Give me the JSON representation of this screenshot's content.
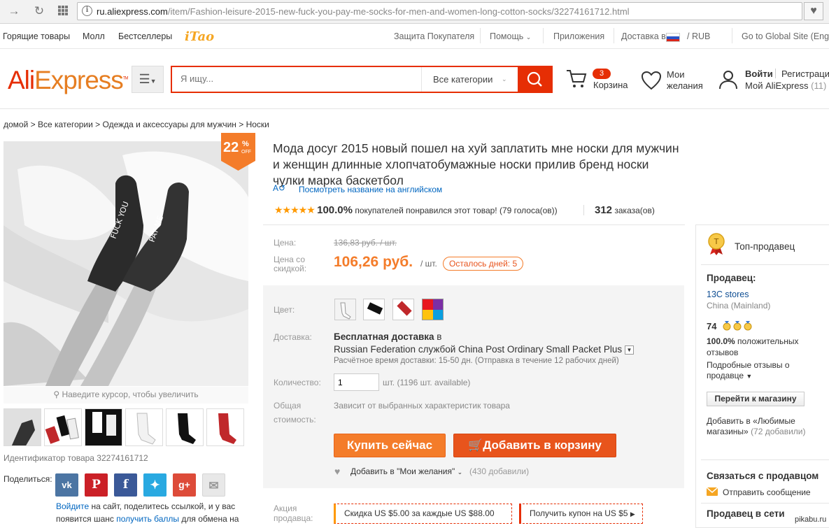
{
  "browser": {
    "url_host": "ru.aliexpress.com",
    "url_path": "/item/Fashion-leisure-2015-new-fuck-you-pay-me-socks-for-men-and-women-long-cotton-socks/32274161712.html"
  },
  "topnav": {
    "left": [
      "Горящие товары",
      "Молл",
      "Бестселлеры"
    ],
    "brand": "iTao",
    "buyer_protection": "Защита Покупателя",
    "help": "Помощь",
    "apps": "Приложения",
    "delivery": "Доставка в",
    "currency": "/ RUB",
    "global": "Go to Global Site (English)"
  },
  "header": {
    "logo_a": "Ali",
    "logo_b": "Express",
    "search_placeholder": "Я ищу...",
    "category": "Все категории",
    "cart_count": "3",
    "cart_label": "Корзина",
    "wish_line1": "Мои",
    "wish_line2": "желания",
    "login": "Войти",
    "register": "Регистрация",
    "my_ali": "Мой AliExpress",
    "my_count": "(11)"
  },
  "breadcrumb": "домой > Все категории > Одежда и аксессуары для мужчин > Носки",
  "gallery": {
    "discount_value": "22",
    "discount_pct": "%",
    "discount_off": "OFF",
    "zoom_hint": "Наведите курсор, чтобы увеличить",
    "product_id": "Идентификатор товара 32274161712"
  },
  "share": {
    "label": "Поделиться:",
    "login_link": "Войдите",
    "text1": " на сайт, поделитесь ссылкой, и у вас появится шанс ",
    "points_link": "получить баллы",
    "text2": " для обмена на"
  },
  "product": {
    "title": "Мода досуг 2015 новый пошел на хуй заплатить мне носки для мужчин и женщин длинные хлопчатобумажные носки прилив бренд носки чулки марка баскетбол",
    "translate": "Посмотреть название на английском",
    "rating_pct": "100.0%",
    "rating_text": "покупателей понравился этот товар! (79 голоса(ов))",
    "orders_count": "312",
    "orders_label": "заказа(ов)"
  },
  "price": {
    "label": "Цена:",
    "old": "136,83 руб. / шт.",
    "discount_label_1": "Цена со",
    "discount_label_2": "скидкой:",
    "new": "106,26 руб.",
    "unit": "/ шт.",
    "days_left": "Осталось дней: 5"
  },
  "sku": {
    "color_label": "Цвет:",
    "shipping_label": "Доставка:",
    "shipping_free": "Бесплатная доставка",
    "shipping_in": "в",
    "shipping_method": "Russian Federation службой China Post Ordinary Small Packet Plus",
    "shipping_time": "Расчётное время доставки: 15-50 дн. (Отправка в течение 12 рабочих дней)",
    "qty_label": "Количество:",
    "qty_value": "1",
    "qty_avail": "шт. (1196 шт. available)",
    "total_label_1": "Общая",
    "total_label_2": "стоимость:",
    "total_value": "Зависит от выбранных характеристик товара",
    "buy_now": "Купить сейчас",
    "add_cart": "Добавить в корзину",
    "wishlist": "Добавить в \"Мои желания\"",
    "wishlist_count": "(430 добавили)"
  },
  "promo": {
    "label_1": "Акция",
    "label_2": "продавца:",
    "coupon1": "Скидка US $5.00 за каждые US $88.00",
    "coupon2": "Получить купон на US $5"
  },
  "seller": {
    "top_badge": "Топ-продавец",
    "seller_label": "Продавец:",
    "store_name": "13C stores",
    "country": "China (Mainland)",
    "score": "74",
    "positive_pct": "100.0%",
    "positive_text1": "положительных",
    "positive_text2": "отзывов",
    "detailed_1": "Подробные отзывы о",
    "detailed_2": "продавце",
    "go_store": "Перейти к магазину",
    "fav_1": "Добавить в «Любимые",
    "fav_2": "магазины»",
    "fav_count": "(72 добавили)",
    "contact_title": "Связаться с продавцом",
    "send_msg": "Отправить сообщение",
    "online_title": "Продавец в сети"
  },
  "watermark": "pikabu.ru",
  "colors": {
    "brand_red": "#e62e04",
    "orange": "#f47c2a",
    "link_blue": "#0066c0"
  }
}
